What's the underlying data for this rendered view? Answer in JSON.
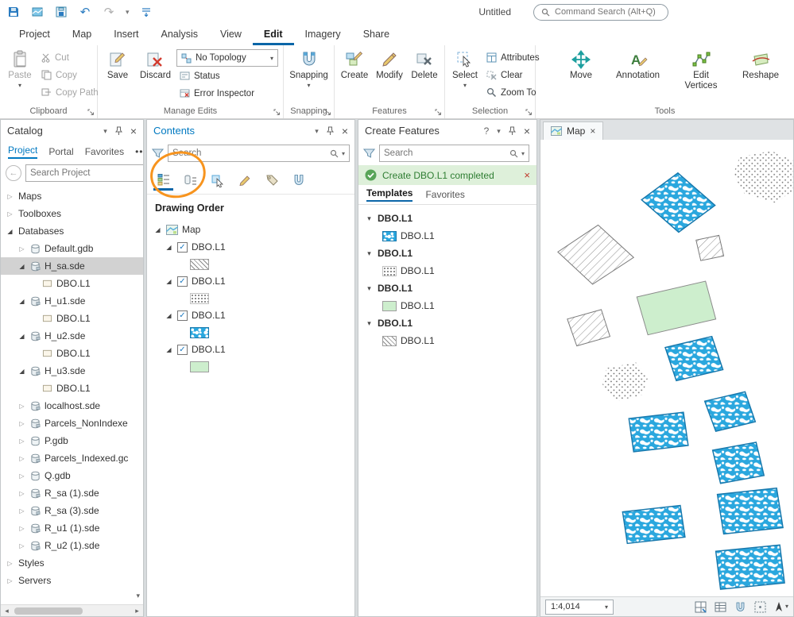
{
  "colors": {
    "accent_blue": "#0079c1",
    "camo_blue": "#2aa7de",
    "green_fill": "#cdeecd",
    "notification_green": "#2e7d32",
    "annotation_orange": "#f7941e",
    "selected_row_gray": "#d2d2d2"
  },
  "qat": {
    "window_title": "Untitled",
    "command_search_placeholder": "Command Search (Alt+Q)"
  },
  "ribbon": {
    "tabs": [
      {
        "label": "Project",
        "active": false
      },
      {
        "label": "Map",
        "active": false
      },
      {
        "label": "Insert",
        "active": false
      },
      {
        "label": "Analysis",
        "active": false
      },
      {
        "label": "View",
        "active": false
      },
      {
        "label": "Edit",
        "active": true
      },
      {
        "label": "Imagery",
        "active": false
      },
      {
        "label": "Share",
        "active": false
      }
    ],
    "clipboard": {
      "label": "Clipboard",
      "paste": "Paste",
      "cut": "Cut",
      "copy": "Copy",
      "copy_path": "Copy Path"
    },
    "manage_edits": {
      "label": "Manage Edits",
      "save": "Save",
      "discard": "Discard",
      "topology": "No Topology",
      "status": "Status",
      "error_inspector": "Error Inspector"
    },
    "snapping": {
      "label": "Snapping",
      "button": "Snapping"
    },
    "features": {
      "label": "Features",
      "create": "Create",
      "modify": "Modify",
      "delete": "Delete"
    },
    "selection": {
      "label": "Selection",
      "select": "Select",
      "attributes": "Attributes",
      "clear": "Clear",
      "zoom_to": "Zoom To"
    },
    "tools": {
      "label": "Tools",
      "move": "Move",
      "annotation": "Annotation",
      "edit_vertices": "Edit Vertices",
      "reshape": "Reshape"
    }
  },
  "catalog": {
    "title": "Catalog",
    "tabs": [
      {
        "label": "Project",
        "active": true
      },
      {
        "label": "Portal",
        "active": false
      },
      {
        "label": "Favorites",
        "active": false
      }
    ],
    "more_label": "•••",
    "search_placeholder": "Search Project",
    "tree": [
      {
        "label": "Maps",
        "depth": 0,
        "state": "collapsed",
        "icon": "none"
      },
      {
        "label": "Toolboxes",
        "depth": 0,
        "state": "collapsed",
        "icon": "none"
      },
      {
        "label": "Databases",
        "depth": 0,
        "state": "expanded",
        "icon": "none"
      },
      {
        "label": "Default.gdb",
        "depth": 1,
        "state": "collapsed",
        "icon": "gdb"
      },
      {
        "label": "H_sa.sde",
        "depth": 1,
        "state": "expanded",
        "icon": "sde",
        "selected": true
      },
      {
        "label": "DBO.L1",
        "depth": 2,
        "state": "leaf",
        "icon": "layer"
      },
      {
        "label": "H_u1.sde",
        "depth": 1,
        "state": "expanded",
        "icon": "sde"
      },
      {
        "label": "DBO.L1",
        "depth": 2,
        "state": "leaf",
        "icon": "layer"
      },
      {
        "label": "H_u2.sde",
        "depth": 1,
        "state": "expanded",
        "icon": "sde"
      },
      {
        "label": "DBO.L1",
        "depth": 2,
        "state": "leaf",
        "icon": "layer"
      },
      {
        "label": "H_u3.sde",
        "depth": 1,
        "state": "expanded",
        "icon": "sde"
      },
      {
        "label": "DBO.L1",
        "depth": 2,
        "state": "leaf",
        "icon": "layer"
      },
      {
        "label": "localhost.sde",
        "depth": 1,
        "state": "collapsed",
        "icon": "sde"
      },
      {
        "label": "Parcels_NonIndexe",
        "depth": 1,
        "state": "collapsed",
        "icon": "sde"
      },
      {
        "label": "P.gdb",
        "depth": 1,
        "state": "collapsed",
        "icon": "gdb"
      },
      {
        "label": "Parcels_Indexed.gc",
        "depth": 1,
        "state": "collapsed",
        "icon": "sde"
      },
      {
        "label": "Q.gdb",
        "depth": 1,
        "state": "collapsed",
        "icon": "gdb"
      },
      {
        "label": "R_sa (1).sde",
        "depth": 1,
        "state": "collapsed",
        "icon": "sde"
      },
      {
        "label": "R_sa (3).sde",
        "depth": 1,
        "state": "collapsed",
        "icon": "sde"
      },
      {
        "label": "R_u1 (1).sde",
        "depth": 1,
        "state": "collapsed",
        "icon": "sde"
      },
      {
        "label": "R_u2 (1).sde",
        "depth": 1,
        "state": "collapsed",
        "icon": "sde"
      },
      {
        "label": "Styles",
        "depth": 0,
        "state": "collapsed",
        "icon": "none"
      },
      {
        "label": "Servers",
        "depth": 0,
        "state": "collapsed",
        "icon": "none"
      }
    ]
  },
  "contents": {
    "title": "Contents",
    "search_placeholder": "Search",
    "toolbar_icons": [
      "list-by-drawing-order",
      "list-by-data-source",
      "list-by-selection",
      "list-by-editing",
      "list-by-labeling",
      "list-by-snapping"
    ],
    "drawing_order_heading": "Drawing Order",
    "map_item": "Map",
    "layers": [
      {
        "label": "DBO.L1",
        "checked": true,
        "swatch": "hatch"
      },
      {
        "label": "DBO.L1",
        "checked": true,
        "swatch": "dots"
      },
      {
        "label": "DBO.L1",
        "checked": true,
        "swatch": "camo"
      },
      {
        "label": "DBO.L1",
        "checked": true,
        "swatch": "green"
      }
    ]
  },
  "create_features": {
    "title": "Create Features",
    "help_label": "?",
    "search_placeholder": "Search",
    "notification": {
      "text": "Create DBO.L1 completed"
    },
    "tabs": [
      {
        "label": "Templates",
        "active": true
      },
      {
        "label": "Favorites",
        "active": false
      }
    ],
    "groups": [
      {
        "label": "DBO.L1",
        "item": {
          "label": "DBO.L1",
          "swatch": "camo"
        }
      },
      {
        "label": "DBO.L1",
        "item": {
          "label": "DBO.L1",
          "swatch": "dots"
        }
      },
      {
        "label": "DBO.L1",
        "item": {
          "label": "DBO.L1",
          "swatch": "green"
        }
      },
      {
        "label": "DBO.L1",
        "item": {
          "label": "DBO.L1",
          "swatch": "hatch"
        }
      }
    ]
  },
  "map_view": {
    "tab_label": "Map",
    "scale": "1:4,014"
  }
}
